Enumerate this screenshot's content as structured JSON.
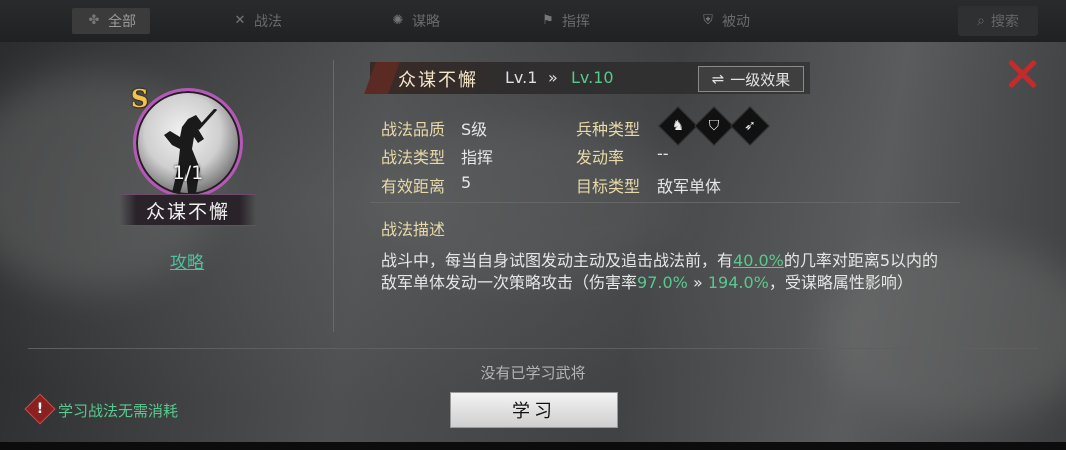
{
  "top_tabs": [
    {
      "label": "全部",
      "icon": "clover-icon",
      "active": true
    },
    {
      "label": "战法",
      "icon": "swords-icon",
      "active": false
    },
    {
      "label": "谋略",
      "icon": "scroll-icon",
      "active": false
    },
    {
      "label": "指挥",
      "icon": "flag-icon",
      "active": false
    },
    {
      "label": "被动",
      "icon": "shield-icon",
      "active": false
    }
  ],
  "search": {
    "label": "搜索",
    "icon": "search-icon"
  },
  "skill": {
    "grade": "S",
    "count": "1/1",
    "name": "众谋不懈",
    "guide_link": "攻略",
    "level_current": "Lv.1",
    "level_arrow": "»",
    "level_max": "Lv.10",
    "effect_button": "一级效果",
    "effect_icon": "⇌"
  },
  "info": {
    "quality_label": "战法品质",
    "quality_value": "S级",
    "type_label": "战法类型",
    "type_value": "指挥",
    "range_label": "有效距离",
    "range_value": "5",
    "troop_label": "兵种类型",
    "rate_label": "发动率",
    "rate_value": "--",
    "target_label": "目标类型",
    "target_value": "敌军单体",
    "troop_icons": [
      "cavalry-icon",
      "shield-troop-icon",
      "archer-icon"
    ]
  },
  "description": {
    "title": "战法描述",
    "line1_a": "战斗中，每当自身试图发动主动及追击战法前，有",
    "line1_pct": "40.0%",
    "line1_b": "的几率对距离5以内的",
    "line2_a": "敌军单体发动一次策略攻击（伤害率",
    "line2_v1": "97.0%",
    "line2_arrow": "»",
    "line2_v2": "194.0%",
    "line2_b": "，受谋略属性影响）"
  },
  "footer": {
    "no_general": "没有已学习武将",
    "learn_button": "学习",
    "warning_text": "学习战法无需消耗",
    "warning_icon": "!"
  },
  "colors": {
    "accent_green": "#58c98e",
    "close_red": "#c62a2a",
    "label_gold": "#e8d9a8",
    "grade_gold": "#f2c34a",
    "portrait_ring": "#b45ab6"
  }
}
